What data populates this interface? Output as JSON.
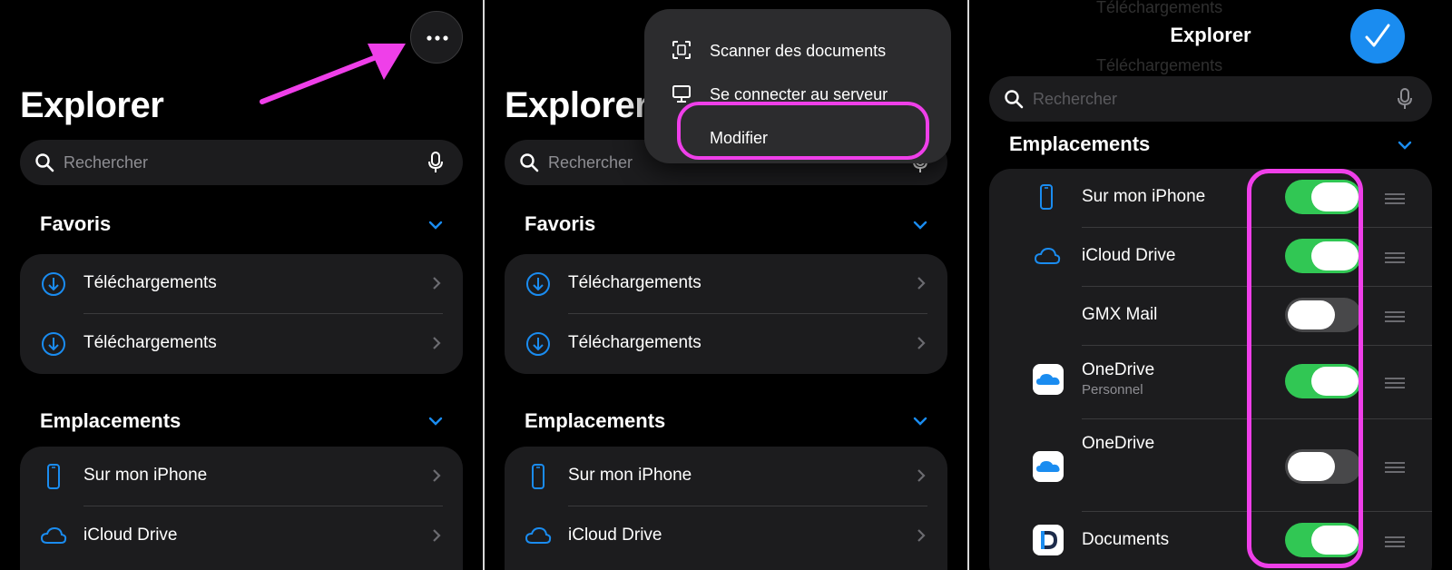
{
  "panel1": {
    "title": "Explorer",
    "search_placeholder": "Rechercher",
    "favorites": {
      "header": "Favoris",
      "items": [
        {
          "label": "Téléchargements",
          "icon": "download-icon"
        },
        {
          "label": "Téléchargements",
          "icon": "download-icon"
        }
      ]
    },
    "locations": {
      "header": "Emplacements",
      "items": [
        {
          "label": "Sur mon iPhone",
          "icon": "iphone-icon"
        },
        {
          "label": "iCloud Drive",
          "icon": "cloud-icon"
        }
      ]
    }
  },
  "panel2": {
    "title": "Explorer",
    "search_placeholder": "Rechercher",
    "menu": [
      {
        "label": "Scanner des documents",
        "icon": "scan-document-icon"
      },
      {
        "label": "Se connecter au serveur",
        "icon": "monitor-icon"
      },
      {
        "label": "Modifier",
        "icon": ""
      }
    ],
    "favorites": {
      "header": "Favoris",
      "items": [
        {
          "label": "Téléchargements",
          "icon": "download-icon"
        },
        {
          "label": "Téléchargements",
          "icon": "download-icon"
        }
      ]
    },
    "locations": {
      "header": "Emplacements",
      "items": [
        {
          "label": "Sur mon iPhone",
          "icon": "iphone-icon"
        },
        {
          "label": "iCloud Drive",
          "icon": "cloud-icon"
        }
      ]
    }
  },
  "panel3": {
    "title": "Explorer",
    "search_placeholder": "Rechercher",
    "locations_header": "Emplacements",
    "faded_rows": [
      "Téléchargements",
      "Téléchargements"
    ],
    "locations": [
      {
        "label": "Sur mon iPhone",
        "sub": "",
        "enabled": true,
        "icon": "iphone-icon"
      },
      {
        "label": "iCloud Drive",
        "sub": "",
        "enabled": true,
        "icon": "cloud-icon"
      },
      {
        "label": "GMX Mail",
        "sub": "",
        "enabled": false,
        "icon": ""
      },
      {
        "label": "OneDrive",
        "sub": "Personnel",
        "enabled": true,
        "icon": "onedrive-icon"
      },
      {
        "label": "OneDrive",
        "sub": "",
        "enabled": false,
        "icon": "onedrive-icon"
      },
      {
        "label": "Documents",
        "sub": "",
        "enabled": true,
        "icon": "documents-app-icon"
      }
    ]
  },
  "colors": {
    "accent_blue": "#1a8cf0",
    "toggle_on": "#31c754",
    "highlight_magenta": "#ef3fe9",
    "card_bg": "#1c1c1e"
  }
}
